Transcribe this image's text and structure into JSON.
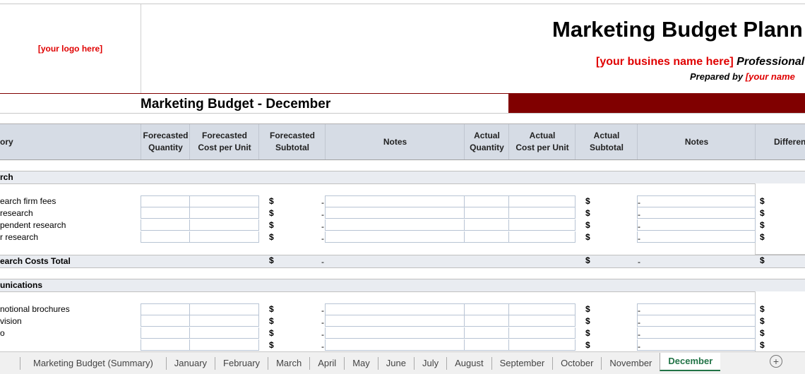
{
  "header": {
    "logo": "[your logo here]",
    "title": "Marketing Budget Plann",
    "business": "[your busines name here]",
    "professional": "Professional",
    "prepared_by": "Prepared by",
    "your_name": "[your name"
  },
  "sheet_title": "Marketing Budget - December",
  "columns": [
    "ory",
    "Forecasted\nQuantity",
    "Forecasted\nCost per Unit",
    "Forecasted\nSubtotal",
    "Notes",
    "Actual\nQuantity",
    "Actual\nCost per Unit",
    "Actual\nSubtotal",
    "Notes",
    "Differen"
  ],
  "sections": [
    {
      "name": "rch",
      "items": [
        "earch firm fees",
        "research",
        "pendent research",
        "r research"
      ],
      "total_label": "earch Costs Total"
    },
    {
      "name": "unications",
      "items": [
        "notional brochures",
        "vision",
        "o",
        ""
      ]
    }
  ],
  "currency": "$",
  "empty_value": "-",
  "tabs": [
    "Marketing Budget (Summary)",
    "January",
    "February",
    "March",
    "April",
    "May",
    "June",
    "July",
    "August",
    "September",
    "October",
    "November",
    "December"
  ],
  "active_tab": "December",
  "colors": {
    "accent_bar": "#800000",
    "placeholder_red": "#e00000",
    "header_bg": "#d6dce5",
    "active_tab": "#217346"
  }
}
